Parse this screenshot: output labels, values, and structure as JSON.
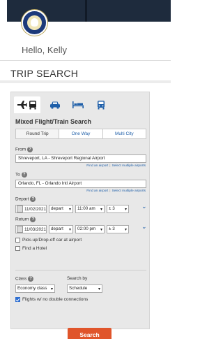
{
  "header": {
    "greeting": "Hello, Kelly"
  },
  "page": {
    "title": "TRIP SEARCH"
  },
  "colors": {
    "accent": "#1f5fa9",
    "search_button": "#e0552b",
    "header_dark": "#1e2b3d"
  },
  "modes": [
    {
      "icon": "plane-train-icon",
      "active": true
    },
    {
      "icon": "car-icon",
      "active": false
    },
    {
      "icon": "hotel-bed-icon",
      "active": false
    },
    {
      "icon": "train-icon",
      "active": false
    }
  ],
  "search": {
    "type_label": "Mixed Flight/Train Search",
    "trip_types": [
      "Round Trip",
      "One Way",
      "Multi City"
    ],
    "selected_trip_type": "Round Trip",
    "from": {
      "label": "From",
      "value": "Shreveport, LA - Shreveport Regional Airport",
      "find_link": "Find an airport",
      "multi_link": "Select multiple airports"
    },
    "to": {
      "label": "To",
      "value": "Orlando, FL - Orlando Intl Airport",
      "find_link": "Find an airport",
      "multi_link": "Select multiple airports"
    },
    "depart": {
      "label": "Depart",
      "date": "11/02/2021",
      "mode": "depart",
      "time": "11:00 am",
      "window": "± 3"
    },
    "return": {
      "label": "Return",
      "date": "11/03/2021",
      "mode": "depart",
      "time": "02:00 pm",
      "window": "± 3"
    },
    "options": [
      {
        "label": "Pick-up/Drop-off car at airport",
        "checked": false
      },
      {
        "label": "Find a Hotel",
        "checked": false
      }
    ],
    "class_label": "Class",
    "class_value": "Economy class",
    "search_by_label": "Search by",
    "search_by_value": "Schedule",
    "no_double_label": "Flights w/ no double connections",
    "no_double_checked": true,
    "submit_label": "Search"
  }
}
